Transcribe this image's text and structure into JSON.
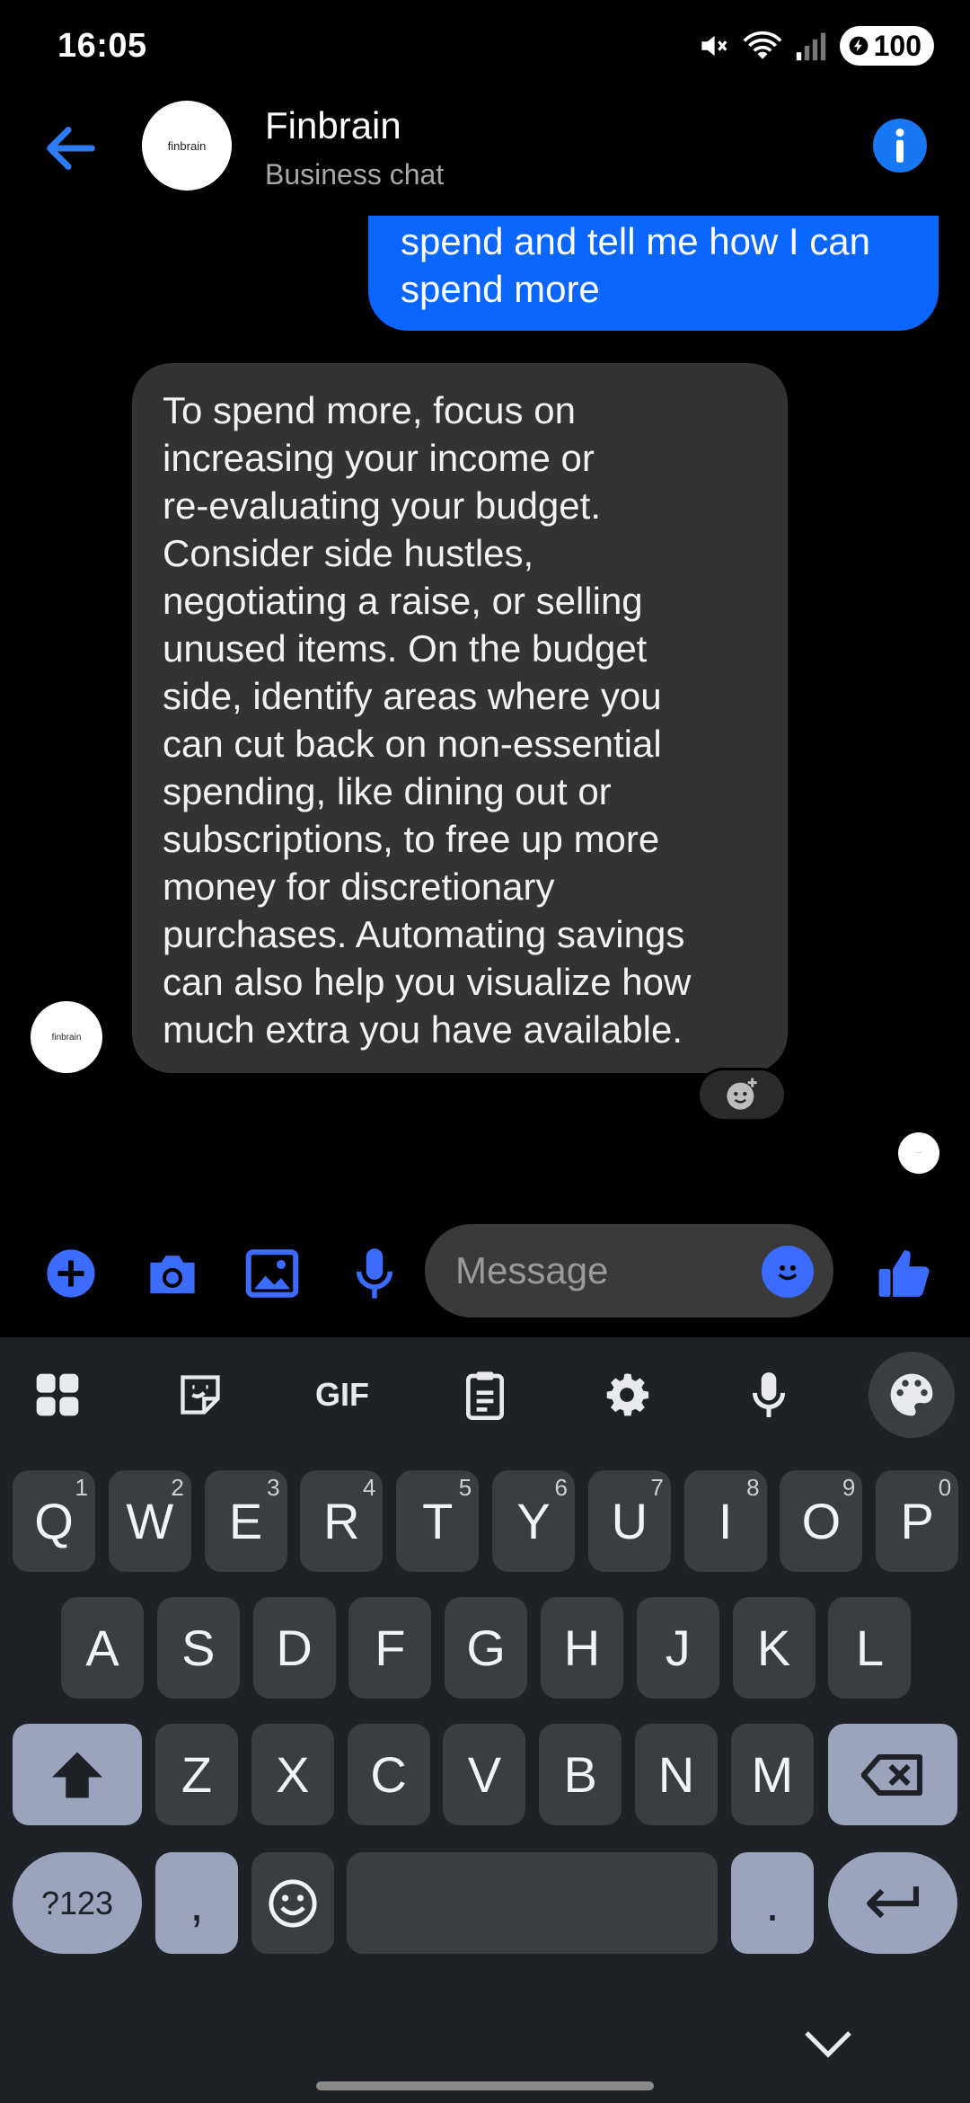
{
  "status_bar": {
    "time": "16:05",
    "battery": "100"
  },
  "header": {
    "avatar_text": "finbrain",
    "title": "Finbrain",
    "subtitle": "Business chat"
  },
  "messages": {
    "outgoing_text": "spend and tell me how I can\nspend more",
    "incoming_text": "To spend more, focus on\nincreasing your income or\nre-evaluating your budget.\nConsider side hustles,\nnegotiating a raise, or selling\nunused items. On the budget\nside, identify areas where you\ncan cut back on non-essential\nspending, like dining out or\nsubscriptions, to free up more\nmoney for discretionary\npurchases. Automating savings\ncan also help you visualize how\nmuch extra you have available.",
    "sender_avatar_text": "finbrain"
  },
  "composer": {
    "placeholder": "Message"
  },
  "keyboard": {
    "toolbar": {
      "gif_label": "GIF"
    },
    "row1": [
      {
        "k": "Q",
        "h": "1"
      },
      {
        "k": "W",
        "h": "2"
      },
      {
        "k": "E",
        "h": "3"
      },
      {
        "k": "R",
        "h": "4"
      },
      {
        "k": "T",
        "h": "5"
      },
      {
        "k": "Y",
        "h": "6"
      },
      {
        "k": "U",
        "h": "7"
      },
      {
        "k": "I",
        "h": "8"
      },
      {
        "k": "O",
        "h": "9"
      },
      {
        "k": "P",
        "h": "0"
      }
    ],
    "row2": [
      "A",
      "S",
      "D",
      "F",
      "G",
      "H",
      "J",
      "K",
      "L"
    ],
    "row3": [
      "Z",
      "X",
      "C",
      "V",
      "B",
      "N",
      "M"
    ],
    "symbols_label": "?123",
    "comma_label": ",",
    "period_label": "."
  },
  "colors": {
    "accent": "#0a66ff",
    "icon_blue": "#3b6bff",
    "bubble_in": "#333333",
    "keyboard_bg": "#1e2126",
    "key_bg": "#3a3d42",
    "func_key_bg": "#9ba3bd"
  }
}
